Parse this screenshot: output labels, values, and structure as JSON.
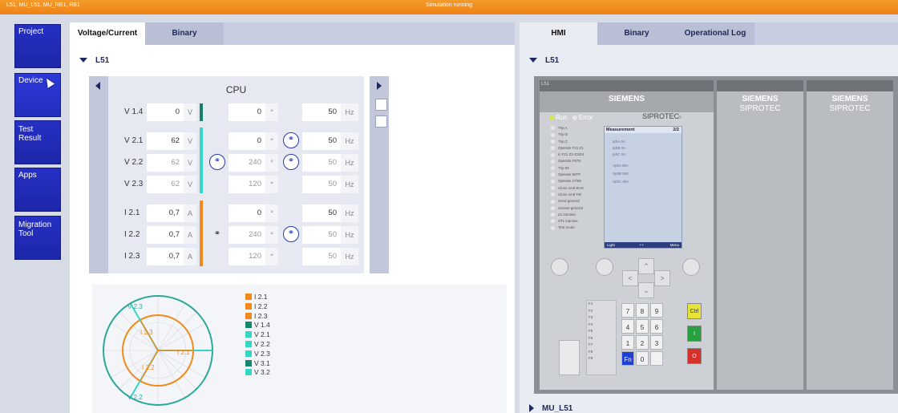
{
  "topbar": {
    "path": "L51, MU_L51, MU_RB1, RB1",
    "status": "Simulation running",
    "accent": "#f08418"
  },
  "nav": {
    "items": [
      {
        "label": "Project"
      },
      {
        "label": "Device"
      },
      {
        "label": "Test Result"
      },
      {
        "label": "Apps"
      },
      {
        "label": "Migration Tool"
      }
    ]
  },
  "left": {
    "tabs": [
      {
        "label": "Voltage/Current"
      },
      {
        "label": "Binary"
      }
    ],
    "section": "L51",
    "cpu_title": "CPU",
    "rows": [
      {
        "label": "V 1.4",
        "mag": "0",
        "mag_unit": "V",
        "angle": "0",
        "angle_unit": "°",
        "freq": "50",
        "freq_unit": "Hz"
      },
      {
        "label": "V 2.1",
        "mag": "62",
        "mag_unit": "V",
        "angle": "0",
        "angle_unit": "°",
        "freq": "50",
        "freq_unit": "Hz"
      },
      {
        "label": "V 2.2",
        "mag": "62",
        "mag_unit": "V",
        "angle": "240",
        "angle_unit": "°",
        "freq": "50",
        "freq_unit": "Hz"
      },
      {
        "label": "V 2.3",
        "mag": "62",
        "mag_unit": "V",
        "angle": "120",
        "angle_unit": "°",
        "freq": "50",
        "freq_unit": "Hz"
      },
      {
        "label": "I 2.1",
        "mag": "0,7",
        "mag_unit": "A",
        "angle": "0",
        "angle_unit": "°",
        "freq": "50",
        "freq_unit": "Hz"
      },
      {
        "label": "I 2.2",
        "mag": "0,7",
        "mag_unit": "A",
        "angle": "240",
        "angle_unit": "°",
        "freq": "50",
        "freq_unit": "Hz"
      },
      {
        "label": "I 2.3",
        "mag": "0,7",
        "mag_unit": "A",
        "angle": "120",
        "angle_unit": "°",
        "freq": "50",
        "freq_unit": "Hz"
      }
    ],
    "phasor_labels": {
      "v23": "V 2.3",
      "i23": "I 2.3",
      "i21": "I 2.1",
      "i22": "I 2.2",
      "v22": "V 2.2"
    },
    "legend": [
      {
        "label": "I 2.1",
        "color": "#f08a1c"
      },
      {
        "label": "I 2.2",
        "color": "#f08a1c"
      },
      {
        "label": "I 2.3",
        "color": "#f08a1c"
      },
      {
        "label": "V 1.4",
        "color": "#138a6e"
      },
      {
        "label": "V 2.1",
        "color": "#35d6c6"
      },
      {
        "label": "V 2.2",
        "color": "#35d6c6"
      },
      {
        "label": "V 2.3",
        "color": "#35d6c6"
      },
      {
        "label": "V 3.1",
        "color": "#138a6e"
      },
      {
        "label": "V 3.2",
        "color": "#35d6c6"
      }
    ],
    "colors": {
      "voltage_dark": "#16806a",
      "voltage": "#35d6c6",
      "current": "#f08a1c"
    }
  },
  "right": {
    "tabs": [
      {
        "label": "HMI"
      },
      {
        "label": "Binary"
      },
      {
        "label": "Operational Log"
      }
    ],
    "section": "L51",
    "bottom_section": "MU_L51",
    "device": {
      "header": "L51",
      "brand": "SIEMENS",
      "model_main": "SIPROTEC",
      "model_suffix": "5",
      "run": "Run",
      "error": "Error",
      "leds": [
        "Trip A",
        "Trip B",
        "Trip C",
        "Operate F21 Z1",
        "Ic F21 Z2-Z3/Z4",
        "Operate F87N",
        "Trip 86",
        "Operate 50TP",
        "Operate 27/59",
        "Close cmd BUS",
        "Close cmd TIE",
        "Send general",
        "receive general",
        "Z1 inactive",
        "STL inactive",
        "Test mode"
      ],
      "screen_title": "Measurement",
      "screen_page": "2/2",
      "measurements": [
        "IphA  0A",
        "IphB  0A",
        "IphC  0A",
        "VphA  0kV",
        "VphB  0kV",
        "VphC  0kV"
      ],
      "softkey_left": "Light",
      "softkey_mid": "• •",
      "softkey_right": "Menu",
      "fkeys": [
        "F1",
        "F2",
        "F3",
        "F4",
        "F5",
        "F6",
        "F7",
        "F8",
        "F9"
      ],
      "keys": [
        "7",
        "8",
        "9",
        "4",
        "5",
        "6",
        "1",
        "2",
        "3",
        "Fn",
        "0",
        "."
      ],
      "ctrl": "Ctrl",
      "close_symbol": "I",
      "open_symbol": "O"
    }
  }
}
